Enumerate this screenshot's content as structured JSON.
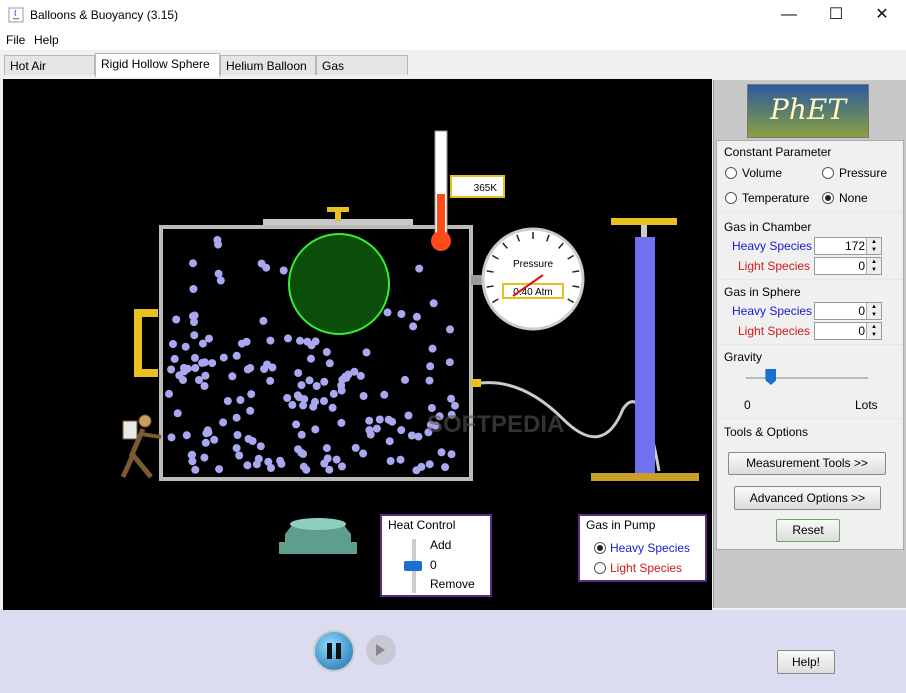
{
  "window": {
    "title": "Balloons & Buoyancy (3.15)"
  },
  "menu": [
    "File",
    "Help"
  ],
  "tabs": [
    {
      "label": "Hot Air Balloon",
      "active": false
    },
    {
      "label": "Rigid Hollow Sphere",
      "active": true
    },
    {
      "label": "Helium Balloon",
      "active": false
    },
    {
      "label": "Gas Properties",
      "active": false
    }
  ],
  "sim": {
    "thermometer": {
      "value": "365K"
    },
    "gauge": {
      "label": "Pressure",
      "value": "0.40 Atm"
    },
    "watermark": "SOFTPEDIA"
  },
  "heat_control": {
    "title": "Heat Control",
    "add": "Add",
    "value": "0",
    "remove": "Remove"
  },
  "gas_in_pump": {
    "title": "Gas in Pump",
    "options": [
      {
        "label": "Heavy Species",
        "selected": true,
        "color": "#1a1ad0"
      },
      {
        "label": "Light Species",
        "selected": false,
        "color": "#d01a1a"
      }
    ]
  },
  "panel": {
    "logo": "PhET",
    "constant_parameter": {
      "title": "Constant Parameter",
      "options": [
        {
          "label": "Volume",
          "selected": false
        },
        {
          "label": "Pressure",
          "selected": false
        },
        {
          "label": "Temperature",
          "selected": false
        },
        {
          "label": "None",
          "selected": true
        }
      ]
    },
    "gas_in_chamber": {
      "title": "Gas in Chamber",
      "heavy_label": "Heavy Species",
      "heavy_value": "172",
      "light_label": "Light Species",
      "light_value": "0"
    },
    "gas_in_sphere": {
      "title": "Gas in Sphere",
      "heavy_label": "Heavy Species",
      "heavy_value": "0",
      "light_label": "Light Species",
      "light_value": "0"
    },
    "gravity": {
      "title": "Gravity",
      "min_label": "0",
      "max_label": "Lots",
      "level": 0.2
    },
    "tools": {
      "title": "Tools & Options",
      "measurement_button": "Measurement Tools >>",
      "advanced_button": "Advanced Options >>"
    },
    "reset_button": "Reset"
  },
  "bottom": {
    "help_button": "Help!"
  },
  "colors": {
    "heavy": "#1a1ad0",
    "light": "#d01a1a",
    "sphere_fill": "#0b4d0b",
    "sphere_stroke": "#33ee33",
    "particle": "#a8a8f0",
    "pump": "#7070f0"
  }
}
